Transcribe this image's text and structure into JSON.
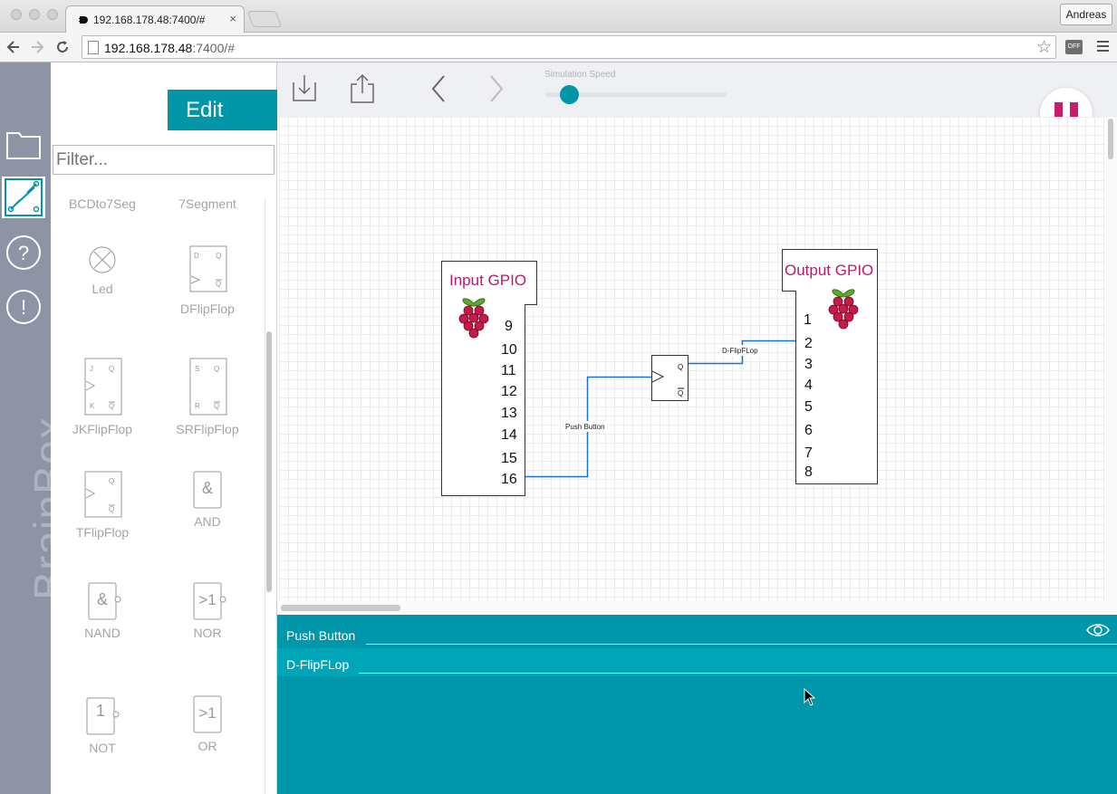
{
  "browser": {
    "tab_title": "192.168.178.48:7400/#",
    "tab_close": "×",
    "profile_name": "Andreas",
    "url_host": "192.168.178.48",
    "url_rest": ":7400/#",
    "extension_badge": "OFF",
    "star_icon": "☆"
  },
  "app": {
    "brand": "BrainBox",
    "edit_label": "Edit",
    "filter_placeholder": "Filter...",
    "rail": [
      "folder-icon",
      "circuit-icon",
      "help-icon",
      "info-icon"
    ],
    "simulation_speed_label": "Simulation Speed",
    "simulation_speed_value": 0.12
  },
  "palette": {
    "items": [
      {
        "label": "BCDto7Seg"
      },
      {
        "label": "7Segment"
      },
      {
        "label": "Led"
      },
      {
        "label": "DFlipFlop"
      },
      {
        "label": "JKFlipFlop"
      },
      {
        "label": "SRFlipFlop"
      },
      {
        "label": "TFlipFlop"
      },
      {
        "label": "AND"
      },
      {
        "label": "NAND"
      },
      {
        "label": "NOR"
      },
      {
        "label": "NOT"
      },
      {
        "label": "OR"
      }
    ],
    "symbols": {
      "and": "&",
      "nand": "&",
      "nor": ">1",
      "not": "1",
      "or": ">1",
      "d_ff": [
        "D",
        "Q",
        "Q"
      ],
      "jk_ff": [
        "J",
        "Q",
        "K",
        "Q"
      ],
      "sr_ff": [
        "S",
        "Q",
        "R",
        "Q"
      ],
      "t_ff": [
        "Q",
        "Q"
      ]
    }
  },
  "circuit": {
    "input": {
      "title": "Input GPIO",
      "pins": [
        "9",
        "10",
        "11",
        "12",
        "13",
        "14",
        "15",
        "16"
      ]
    },
    "output": {
      "title": "Output GPIO",
      "pins": [
        "1",
        "2",
        "3",
        "4",
        "5",
        "6",
        "7",
        "8"
      ]
    },
    "flipflop": {
      "q": "Q",
      "qbar": "Q"
    },
    "wire_labels": {
      "push": "Push Button",
      "dff": "D-FlipFLop"
    },
    "wire_color": "#1a6fd8",
    "accent": "#c0176d"
  },
  "probes": {
    "rows": [
      {
        "name": "Push Button"
      },
      {
        "name": "D-FlipFLop"
      }
    ],
    "panel_color": "#0097aa"
  }
}
